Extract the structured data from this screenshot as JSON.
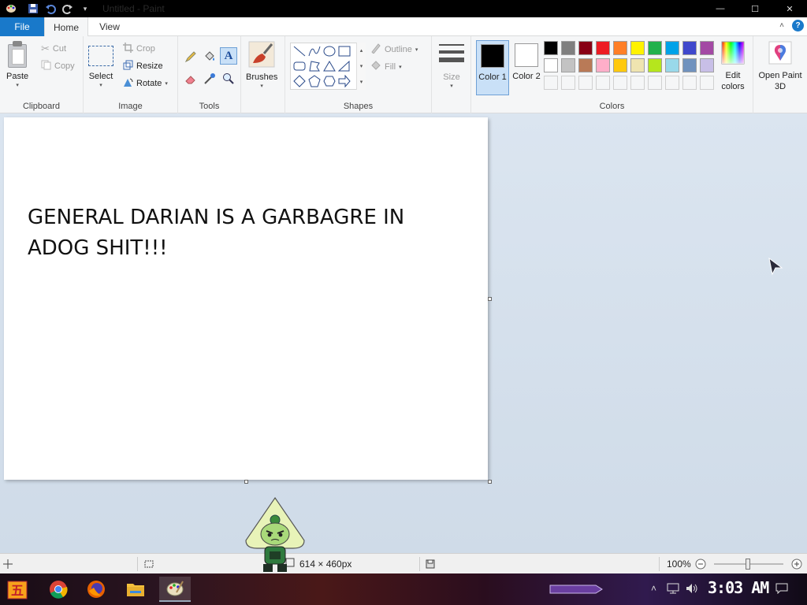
{
  "window": {
    "title": "Untitled - Paint",
    "minimize_glyph": "—",
    "maximize_glyph": "☐",
    "close_glyph": "✕"
  },
  "tabs": [
    {
      "label": "File"
    },
    {
      "label": "Home"
    },
    {
      "label": "View"
    }
  ],
  "help_glyph": "?",
  "ribbon": {
    "clipboard": {
      "label": "Clipboard",
      "paste": "Paste",
      "cut": "Cut",
      "copy": "Copy"
    },
    "image": {
      "label": "Image",
      "select": "Select",
      "crop": "Crop",
      "resize": "Resize",
      "rotate": "Rotate"
    },
    "tools": {
      "label": "Tools",
      "items": [
        "pencil-icon",
        "fill-bucket-icon",
        "text-icon",
        "eraser-icon",
        "color-picker-icon",
        "magnifier-icon"
      ],
      "text_glyph": "A"
    },
    "brushes": {
      "label": "Brushes"
    },
    "shapes": {
      "label": "Shapes",
      "outline": "Outline",
      "fill": "Fill"
    },
    "size": {
      "label": "Size"
    },
    "colors": {
      "label": "Colors",
      "color1_label": "Color 1",
      "color2_label": "Color 2",
      "color1": "#000000",
      "color2": "#ffffff",
      "edit_colors": "Edit colors",
      "palette_row1": [
        "#000000",
        "#7f7f7f",
        "#880015",
        "#ed1c24",
        "#ff7f27",
        "#fff200",
        "#22b14c",
        "#00a2e8",
        "#3f48cc",
        "#a349a4"
      ],
      "palette_row2": [
        "#ffffff",
        "#c3c3c3",
        "#b97a57",
        "#ffaec9",
        "#ffc90e",
        "#efe4b0",
        "#b5e61d",
        "#99d9ea",
        "#7092be",
        "#c8bfe7"
      ]
    },
    "paint3d": {
      "label": "Open Paint 3D"
    }
  },
  "canvas": {
    "text": "GENERAL DARIAN IS A GARBAGRE IN ADOG SHIT!!!"
  },
  "statusbar": {
    "dimensions": "614 × 460px",
    "zoom": "100%",
    "zoom_level": 1.0
  },
  "taskbar": {
    "clock": "3:03 AM",
    "apps": [
      "start-icon",
      "chrome-icon",
      "firefox-icon",
      "file-explorer-icon",
      "paint-icon"
    ]
  }
}
